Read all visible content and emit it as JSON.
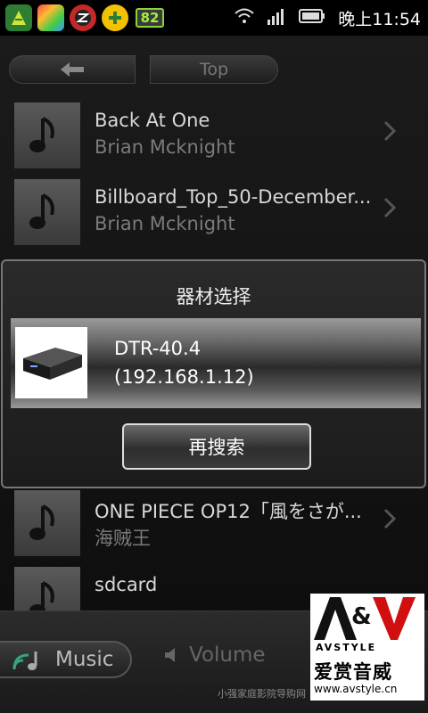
{
  "status_bar": {
    "battery_badge": "82",
    "time": "晚上11:54",
    "icons": [
      "app-notification-icon",
      "game-icon",
      "z-app-icon",
      "plus-icon",
      "wifi-icon",
      "signal-icon",
      "battery-icon"
    ]
  },
  "nav": {
    "back_icon": "arrow-left-icon",
    "top_label": "Top"
  },
  "songs": [
    {
      "title": "Back At One",
      "artist": "Brian Mcknight"
    },
    {
      "title": "Billboard_Top_50-December...",
      "artist": "Brian Mcknight"
    },
    {
      "title": "ONE PIECE OP12「風をさが...",
      "artist": "海贼王"
    },
    {
      "title": "sdcard",
      "artist": ""
    }
  ],
  "dialog": {
    "title": "器材选择",
    "device_name": "DTR-40.4",
    "device_ip": "(192.168.1.12)",
    "rescan_label": "再搜索"
  },
  "bottom": {
    "music_label": "Music",
    "volume_label": "Volume"
  },
  "logo": {
    "mark": "A&V",
    "sub": "AVSTYLE",
    "cn": "爱赏音威",
    "url": "www.avstyle.cn"
  },
  "watermark": "小强家庭影院导购网"
}
